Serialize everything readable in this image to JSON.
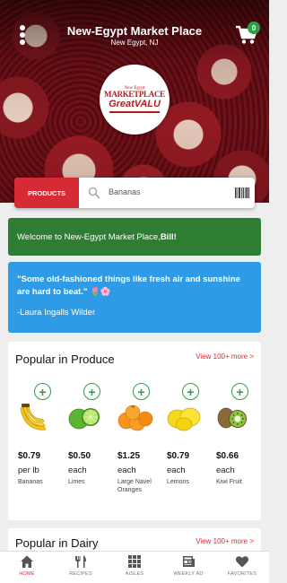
{
  "header": {
    "store_title": "New-Egypt Market Place",
    "store_location": "New Egypt, NJ",
    "cart_count": "0"
  },
  "logo": {
    "small_text": "New Egypt",
    "main_text": "MARKETPLACE",
    "brand": "GreatVALU"
  },
  "search": {
    "category_button": "PRODUCTS",
    "query": "Bananas"
  },
  "welcome": {
    "prefix": "Welcome to New-Egypt Market Place, ",
    "user": "Bill",
    "suffix": "!"
  },
  "quote": {
    "text": "\"Some old-fashioned things like fresh air and sunshine are hard to beat.\" 🌷🌸",
    "author": "-Laura Ingalls Wilder"
  },
  "produce": {
    "title": "Popular in Produce",
    "view_more": "View 100+ more >",
    "items": [
      {
        "price": "$0.79",
        "unit": "per lb",
        "name": "Bananas",
        "icon": "banana-icon"
      },
      {
        "price": "$0.50",
        "unit": "each",
        "name": "Limes",
        "icon": "lime-icon"
      },
      {
        "price": "$1.25",
        "unit": "each",
        "name": "Large Navel Oranges",
        "icon": "orange-icon"
      },
      {
        "price": "$0.79",
        "unit": "each",
        "name": "Lemons",
        "icon": "lemon-icon"
      },
      {
        "price": "$0.66",
        "unit": "each",
        "name": "Kiwi Fruit",
        "icon": "kiwi-icon"
      }
    ]
  },
  "dairy": {
    "title": "Popular in Dairy",
    "view_more": "View 100+ more >"
  },
  "nav": [
    {
      "label": "HOME",
      "icon": "home-icon",
      "active": true
    },
    {
      "label": "RECIPES",
      "icon": "utensils-icon",
      "active": false
    },
    {
      "label": "AISLES",
      "icon": "grid-icon",
      "active": false
    },
    {
      "label": "WEEKLY AD",
      "icon": "newspaper-icon",
      "active": false
    },
    {
      "label": "FAVORITES",
      "icon": "heart-icon",
      "active": false
    }
  ],
  "colors": {
    "accent_red": "#d62a35",
    "welcome_green": "#2e7d32",
    "quote_blue": "#2f9be6",
    "add_green": "#2ea043"
  }
}
